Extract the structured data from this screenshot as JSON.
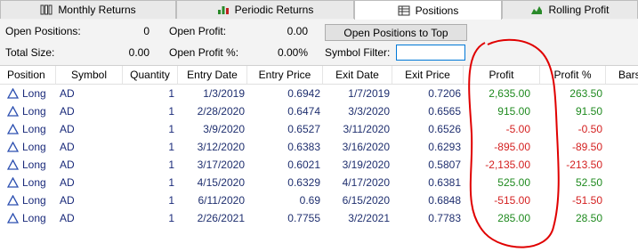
{
  "tabs": [
    {
      "label": "Monthly Returns",
      "icon": "monthly-returns-icon"
    },
    {
      "label": "Periodic Returns",
      "icon": "periodic-returns-icon"
    },
    {
      "label": "Positions",
      "icon": "positions-icon"
    },
    {
      "label": "Rolling Profit",
      "icon": "rolling-profit-icon"
    }
  ],
  "summary": {
    "open_positions_label": "Open Positions:",
    "open_positions_value": "0",
    "open_profit_label": "Open Profit:",
    "open_profit_value": "0.00",
    "total_size_label": "Total Size:",
    "total_size_value": "0.00",
    "open_profit_pct_label": "Open Profit %:",
    "open_profit_pct_value": "0.00%",
    "symbol_filter_label": "Symbol Filter:",
    "symbol_filter_value": "",
    "open_positions_top_label": "Open Positions to Top"
  },
  "table": {
    "columns": [
      "Position",
      "Symbol",
      "Quantity",
      "Entry Date",
      "Entry Price",
      "Exit Date",
      "Exit Price",
      "Profit",
      "Profit %",
      "Bars"
    ],
    "rows": [
      {
        "position": "Long",
        "symbol": "AD",
        "quantity": "1",
        "entry_date": "1/3/2019",
        "entry_price": "0.6942",
        "exit_date": "1/7/2019",
        "exit_price": "0.7206",
        "profit": "2,635.00",
        "profit_pct": "263.50",
        "positive": true
      },
      {
        "position": "Long",
        "symbol": "AD",
        "quantity": "1",
        "entry_date": "2/28/2020",
        "entry_price": "0.6474",
        "exit_date": "3/3/2020",
        "exit_price": "0.6565",
        "profit": "915.00",
        "profit_pct": "91.50",
        "positive": true
      },
      {
        "position": "Long",
        "symbol": "AD",
        "quantity": "1",
        "entry_date": "3/9/2020",
        "entry_price": "0.6527",
        "exit_date": "3/11/2020",
        "exit_price": "0.6526",
        "profit": "-5.00",
        "profit_pct": "-0.50",
        "positive": false
      },
      {
        "position": "Long",
        "symbol": "AD",
        "quantity": "1",
        "entry_date": "3/12/2020",
        "entry_price": "0.6383",
        "exit_date": "3/16/2020",
        "exit_price": "0.6293",
        "profit": "-895.00",
        "profit_pct": "-89.50",
        "positive": false
      },
      {
        "position": "Long",
        "symbol": "AD",
        "quantity": "1",
        "entry_date": "3/17/2020",
        "entry_price": "0.6021",
        "exit_date": "3/19/2020",
        "exit_price": "0.5807",
        "profit": "-2,135.00",
        "profit_pct": "-213.50",
        "positive": false
      },
      {
        "position": "Long",
        "symbol": "AD",
        "quantity": "1",
        "entry_date": "4/15/2020",
        "entry_price": "0.6329",
        "exit_date": "4/17/2020",
        "exit_price": "0.6381",
        "profit": "525.00",
        "profit_pct": "52.50",
        "positive": true
      },
      {
        "position": "Long",
        "symbol": "AD",
        "quantity": "1",
        "entry_date": "6/11/2020",
        "entry_price": "0.69",
        "exit_date": "6/15/2020",
        "exit_price": "0.6848",
        "profit": "-515.00",
        "profit_pct": "-51.50",
        "positive": false
      },
      {
        "position": "Long",
        "symbol": "AD",
        "quantity": "1",
        "entry_date": "2/26/2021",
        "entry_price": "0.7755",
        "exit_date": "3/2/2021",
        "exit_price": "0.7783",
        "profit": "285.00",
        "profit_pct": "28.50",
        "positive": true
      }
    ]
  },
  "colors": {
    "positive": "#1f8a1f",
    "negative": "#d42020",
    "annotation": "#e00000",
    "text_blue": "#1a2a7a"
  }
}
